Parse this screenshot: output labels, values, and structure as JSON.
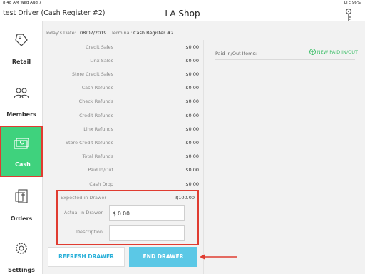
{
  "status_bar": {
    "time": "8:48 AM  Wed Aug 7",
    "right": "LTE 96%"
  },
  "header": {
    "driver": "test Driver (Cash Register #2)",
    "shop": "LA Shop"
  },
  "sidebar": {
    "items": [
      {
        "label": "Retail",
        "icon": "tag-icon"
      },
      {
        "label": "Members",
        "icon": "people-icon"
      },
      {
        "label": "Cash",
        "icon": "cash-icon",
        "active": true
      },
      {
        "label": "Orders",
        "icon": "orders-icon"
      },
      {
        "label": "Settings",
        "icon": "gear-icon"
      }
    ]
  },
  "info": {
    "date_label": "Today's Date:",
    "date_value": "08/07/2019",
    "terminal_label": "Terminal:",
    "terminal_value": "Cash Register #2"
  },
  "summary": [
    {
      "label": "Credit Sales",
      "value": "$0.00"
    },
    {
      "label": "Linx Sales",
      "value": "$0.00"
    },
    {
      "label": "Store Credit Sales",
      "value": "$0.00"
    },
    {
      "label": "Cash Refunds",
      "value": "$0.00"
    },
    {
      "label": "Check Refunds",
      "value": "$0.00"
    },
    {
      "label": "Credit Refunds",
      "value": "$0.00"
    },
    {
      "label": "Linx Refunds",
      "value": "$0.00"
    },
    {
      "label": "Store Credit Refunds",
      "value": "$0.00"
    },
    {
      "label": "Total Refunds",
      "value": "$0.00"
    },
    {
      "label": "Paid In/Out",
      "value": "$0.00"
    },
    {
      "label": "Cash Drop",
      "value": "$0.00"
    }
  ],
  "drawer": {
    "expected_label": "Expected in Drawer",
    "expected_value": "$100.00",
    "actual_label": "Actual in Drawer",
    "actual_value": "$ 0.00",
    "description_label": "Description",
    "description_value": ""
  },
  "paid": {
    "label": "Paid In/Out Items:",
    "new_button": "NEW PAID IN/OUT"
  },
  "buttons": {
    "refresh": "REFRESH DRAWER",
    "end": "END DRAWER"
  },
  "colors": {
    "accent_green": "#3fd27d",
    "highlight_red": "#e03c31",
    "button_blue": "#5bc8e6",
    "link_blue": "#2ab0d9"
  }
}
